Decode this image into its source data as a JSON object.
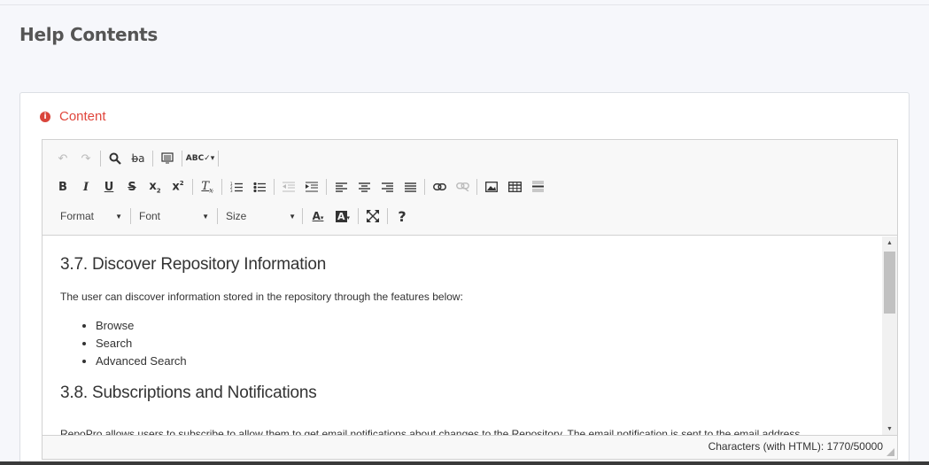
{
  "page": {
    "title": "Help Contents"
  },
  "section": {
    "label": "Content"
  },
  "toolbar": {
    "format_label": "Format",
    "font_label": "Font",
    "size_label": "Size",
    "help_label": "?"
  },
  "content": {
    "heading1": "3.7. Discover Repository Information",
    "paragraph1": "The user can discover information stored in the repository through the features below:",
    "list": [
      "Browse",
      "Search",
      "Advanced Search"
    ],
    "heading2": "3.8. Subscriptions and Notifications",
    "paragraph2": "RepoPro allows users to subscribe to allow them to get email notifications about changes to the Repository. The email notification is sent to the email address"
  },
  "status": {
    "char_count": "Characters (with HTML): 1770/50000"
  },
  "colors": {
    "accent": "#e0463c",
    "toolbar_bg": "#f8f8f8"
  }
}
